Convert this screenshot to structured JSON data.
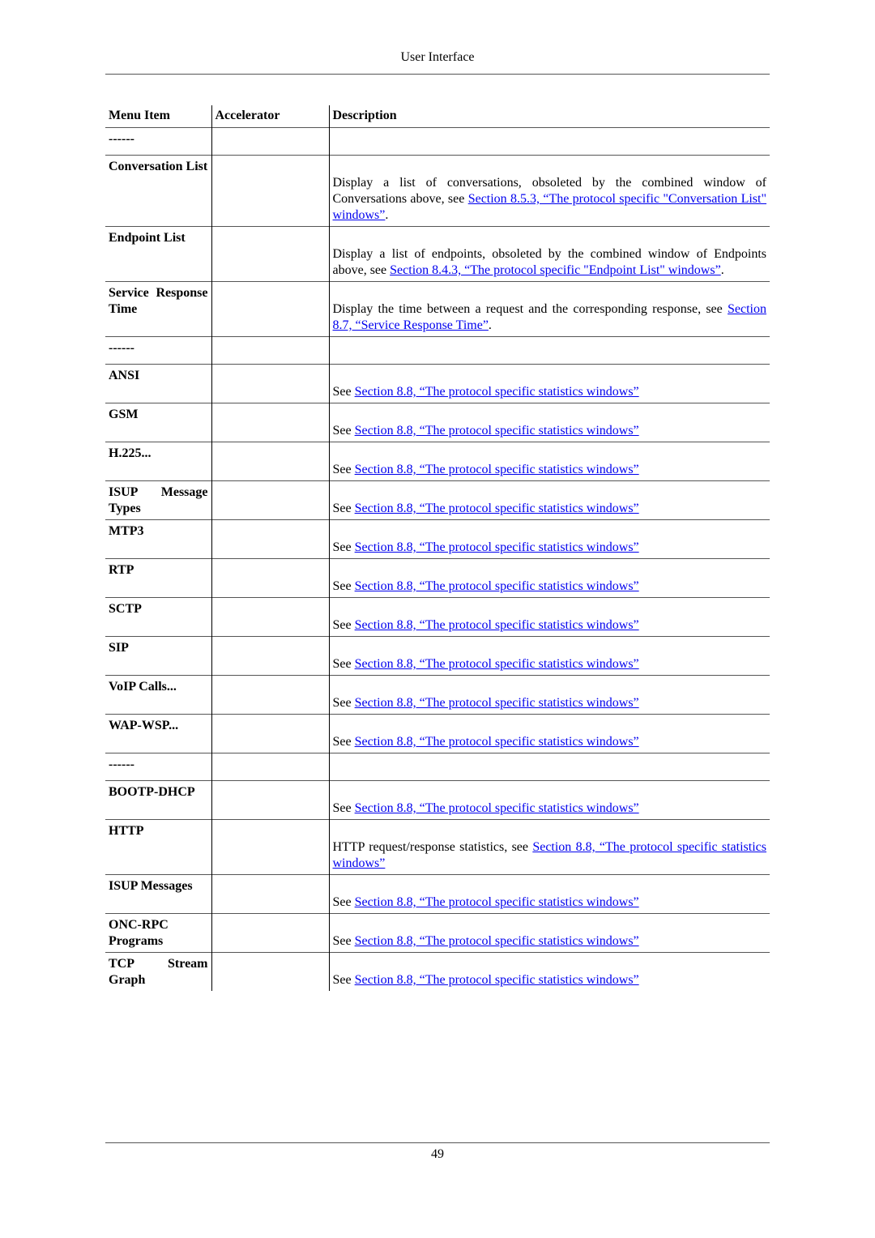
{
  "page": {
    "header": "User Interface",
    "page_number": "49"
  },
  "table": {
    "columns": [
      "Menu Item",
      "Accelerator",
      "Description"
    ],
    "rows": [
      {
        "item": "------",
        "accelerator": "",
        "desc_pre": "",
        "link": "",
        "desc_post": ""
      },
      {
        "item": "Conversation List",
        "accelerator": "",
        "desc_pre": "Display a list of conversations, obsoleted by the combined window of Conversations above, see ",
        "link": "Section 8.5.3, “The protocol specific \"Conversation List\" windows”",
        "desc_post": "."
      },
      {
        "item": "Endpoint List",
        "accelerator": "",
        "desc_pre": "Display a list of endpoints, obsoleted by the combined window of Endpoints above, see ",
        "link": "Section 8.4.3, “The protocol specific \"Endpoint List\" windows”",
        "desc_post": "."
      },
      {
        "item": "Service Response Time",
        "accelerator": "",
        "desc_pre": "Display the time between a request and the corresponding response, see ",
        "link": "Section 8.7, “Service Response Time”",
        "desc_post": "."
      },
      {
        "item": "------",
        "accelerator": "",
        "desc_pre": "",
        "link": "",
        "desc_post": ""
      },
      {
        "item": "ANSI",
        "accelerator": "",
        "desc_pre": "See ",
        "link": "Section 8.8, “The protocol specific statistics windows”",
        "desc_post": ""
      },
      {
        "item": "GSM",
        "accelerator": "",
        "desc_pre": "See ",
        "link": "Section 8.8, “The protocol specific statistics windows”",
        "desc_post": ""
      },
      {
        "item": "H.225...",
        "accelerator": "",
        "desc_pre": "See ",
        "link": "Section 8.8, “The protocol specific statistics windows”",
        "desc_post": ""
      },
      {
        "item": "ISUP Message Types",
        "accelerator": "",
        "desc_pre": "See ",
        "link": "Section 8.8, “The protocol specific statistics windows”",
        "desc_post": ""
      },
      {
        "item": "MTP3",
        "accelerator": "",
        "desc_pre": "See ",
        "link": "Section 8.8, “The protocol specific statistics windows”",
        "desc_post": ""
      },
      {
        "item": "RTP",
        "accelerator": "",
        "desc_pre": "See ",
        "link": "Section 8.8, “The protocol specific statistics windows”",
        "desc_post": ""
      },
      {
        "item": "SCTP",
        "accelerator": "",
        "desc_pre": "See ",
        "link": "Section 8.8, “The protocol specific statistics windows”",
        "desc_post": ""
      },
      {
        "item": "SIP",
        "accelerator": "",
        "desc_pre": "See ",
        "link": "Section 8.8, “The protocol specific statistics windows”",
        "desc_post": ""
      },
      {
        "item": "VoIP Calls...",
        "accelerator": "",
        "desc_pre": "See ",
        "link": "Section 8.8, “The protocol specific statistics windows”",
        "desc_post": ""
      },
      {
        "item": "WAP-WSP...",
        "accelerator": "",
        "desc_pre": "See ",
        "link": "Section 8.8, “The protocol specific statistics windows”",
        "desc_post": ""
      },
      {
        "item": "------",
        "accelerator": "",
        "desc_pre": "",
        "link": "",
        "desc_post": ""
      },
      {
        "item": "BOOTP-DHCP",
        "accelerator": "",
        "desc_pre": "See ",
        "link": "Section 8.8, “The protocol specific statistics windows”",
        "desc_post": ""
      },
      {
        "item": "HTTP",
        "accelerator": "",
        "desc_pre": "HTTP request/response statistics, see ",
        "link": "Section 8.8, “The protocol specific statistics windows”",
        "desc_post": ""
      },
      {
        "item": "ISUP Messages",
        "accelerator": "",
        "desc_pre": "See ",
        "link": "Section 8.8, “The protocol specific statistics windows”",
        "desc_post": ""
      },
      {
        "item": "ONC-RPC Programs",
        "accelerator": "",
        "desc_pre": "See ",
        "link": "Section 8.8, “The protocol specific statistics windows”",
        "desc_post": ""
      },
      {
        "item": "TCP Stream Graph",
        "accelerator": "",
        "desc_pre": "See ",
        "link": "Section 8.8, “The protocol specific statistics windows”",
        "desc_post": ""
      }
    ]
  },
  "colors": {
    "link": "#0000ee",
    "rule": "#555555"
  }
}
